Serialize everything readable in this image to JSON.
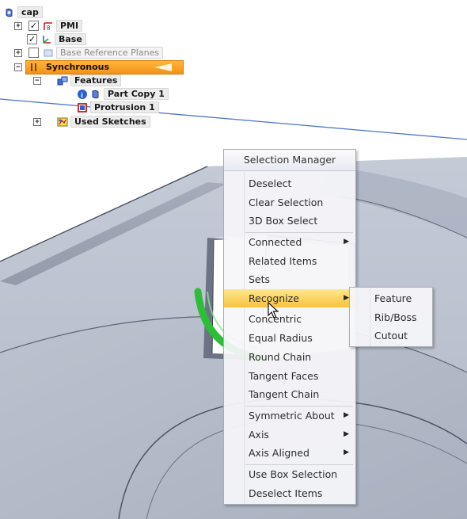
{
  "tree": {
    "root": "cap",
    "pmi": "PMI",
    "base": "Base",
    "base_ref_planes": "Base Reference Planes",
    "synchronous": "Synchronous",
    "features": "Features",
    "part_copy": "Part Copy 1",
    "protrusion": "Protrusion 1",
    "used_sketches": "Used Sketches"
  },
  "selection_menu": {
    "title": "Selection Manager",
    "items": [
      "Deselect",
      "Clear Selection",
      "3D Box Select",
      "Connected",
      "Related Items",
      "Sets",
      "Recognize",
      "Concentric",
      "Equal Radius",
      "Round Chain",
      "Tangent Faces",
      "Tangent Chain",
      "Symmetric About",
      "Axis",
      "Axis Aligned",
      "Use Box Selection",
      "Deselect Items"
    ]
  },
  "recognize_submenu": {
    "items": [
      "Feature",
      "Rib/Boss",
      "Cutout"
    ]
  },
  "colors": {
    "synchronous_highlight": "#f7a12b",
    "menu_highlight": "#f7c33f",
    "model_face": "#b9c0cd",
    "selected_edge": "#2ebd36"
  }
}
